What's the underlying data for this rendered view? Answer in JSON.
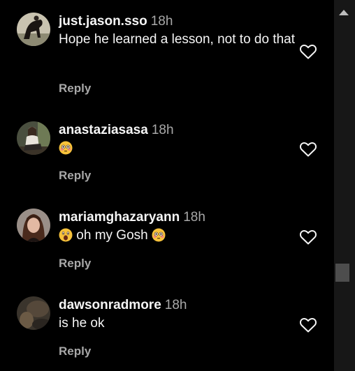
{
  "comments": [
    {
      "username": "just.jason.sso",
      "time": "18h",
      "text": "Hope he learned a lesson, not to do that",
      "reply_label": "Reply",
      "like_icon": "heart-outline-icon",
      "avatar": "horse-rider-photo"
    },
    {
      "username": "anastaziasasa",
      "time": "18h",
      "text": "",
      "emojis": [
        "flushed-face"
      ],
      "reply_label": "Reply",
      "like_icon": "heart-outline-icon",
      "avatar": "woman-sitting-photo"
    },
    {
      "username": "mariamghazaryann",
      "time": "18h",
      "text_before": "",
      "text": "oh my Gosh",
      "emojis": [
        "astonished-face",
        "flushed-face"
      ],
      "reply_label": "Reply",
      "like_icon": "heart-outline-icon",
      "avatar": "woman-portrait-photo"
    },
    {
      "username": "dawsonradmore",
      "time": "18h",
      "text": "is he ok",
      "reply_label": "Reply",
      "like_icon": "heart-outline-icon",
      "avatar": "blurry-dark-photo"
    }
  ],
  "colors": {
    "background": "#000000",
    "primary_text": "#f5f5f5",
    "secondary_text": "#a8a8a8",
    "scrollbar_track": "#171717",
    "scrollbar_thumb": "#4d4d4d"
  },
  "scrollbar": {
    "position_fraction": 0.73
  }
}
